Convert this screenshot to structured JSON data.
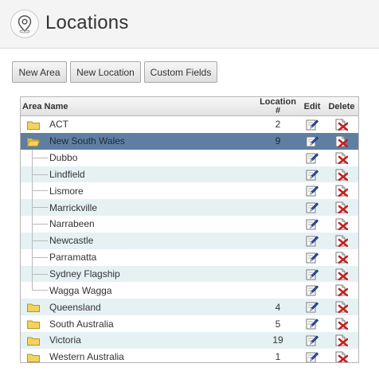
{
  "header": {
    "title": "Locations",
    "icon": "map-pin-icon"
  },
  "toolbar": {
    "new_area_label": "New Area",
    "new_location_label": "New Location",
    "custom_fields_label": "Custom Fields"
  },
  "grid": {
    "columns": {
      "area_name": "Area Name",
      "location_count": "Location #",
      "edit": "Edit",
      "delete": "Delete"
    },
    "rows": [
      {
        "type": "area",
        "name": "ACT",
        "count": "2"
      },
      {
        "type": "area",
        "name": "New South Wales",
        "count": "9",
        "expanded": true,
        "selected": true
      },
      {
        "type": "location",
        "name": "Dubbo"
      },
      {
        "type": "location",
        "name": "Lindfield"
      },
      {
        "type": "location",
        "name": "Lismore"
      },
      {
        "type": "location",
        "name": "Marrickville"
      },
      {
        "type": "location",
        "name": "Narrabeen"
      },
      {
        "type": "location",
        "name": "Newcastle"
      },
      {
        "type": "location",
        "name": "Parramatta"
      },
      {
        "type": "location",
        "name": "Sydney Flagship"
      },
      {
        "type": "location",
        "name": "Wagga Wagga",
        "last_child": true
      },
      {
        "type": "area",
        "name": "Queensland",
        "count": "4"
      },
      {
        "type": "area",
        "name": "South Australia",
        "count": "5"
      },
      {
        "type": "area",
        "name": "Victoria",
        "count": "19"
      },
      {
        "type": "area",
        "name": "Western Australia",
        "count": "1"
      }
    ]
  },
  "colors": {
    "selected_row": "#5e7fa2",
    "alt_row": "#e6f1f4",
    "folder": "#f2d35b",
    "delete_x": "#c41f1f"
  }
}
